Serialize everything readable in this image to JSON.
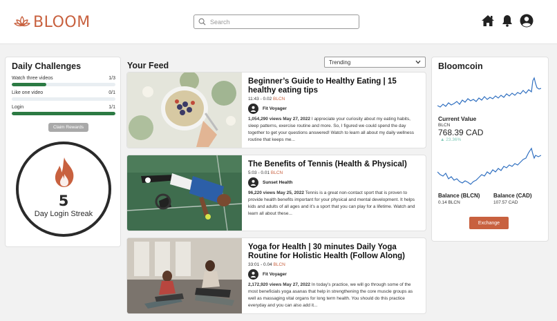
{
  "header": {
    "logo_text": "BLOOM",
    "search_placeholder": "Search"
  },
  "colors": {
    "brand": "#c8613f",
    "progress": "#2b7a43",
    "chart_line": "#2f6fc0"
  },
  "daily_challenges": {
    "title": "Daily Challenges",
    "items": [
      {
        "label": "Watch three videos",
        "progress": "1/3",
        "fraction": 0.333
      },
      {
        "label": "Like one video",
        "progress": "0/1",
        "fraction": 0
      },
      {
        "label": "Login",
        "progress": "1/1",
        "fraction": 1
      }
    ],
    "claim_label": "Claim Rewards",
    "streak_number": "5",
    "streak_label": "Day Login Streak"
  },
  "feed": {
    "title": "Your Feed",
    "sort_selected": "Trending",
    "videos": [
      {
        "title": "Beginner’s Guide to Healthy Eating | 15 healthy eating tips",
        "duration": "11:43 - 0.02",
        "coin": "BLCN",
        "channel": "Fit Voyager",
        "views": "1,054,290 views",
        "date": "May 27, 2022",
        "description": "I appreciate your curiosity about my eating habits, sleep patterns, exercise routine and more. So, I figured we could spend the day together to get your questions answered! Watch to learn all about my daily wellness routine that keeps me..."
      },
      {
        "title": "The Benefits of Tennis (Health & Physical)",
        "duration": "5:03 - 0.01",
        "coin": "BLCN",
        "channel": "Sunset Health",
        "views": "96,220 views",
        "date": "May 25, 2022",
        "description": "Tennis is a great non-contact sport that is proven to provide health benefits important for your physical and mental development. It helps kids and adults of all ages and it’s a sport that you can play for a lifetime. Watch and learn all about these..."
      },
      {
        "title": "Yoga for Health | 30 minutes Daily Yoga Routine for Holistic Health (Follow Along)",
        "duration": "33:01 - 0.04",
        "coin": "BLCN",
        "channel": "Fit Voyager",
        "views": "2,172,920 views",
        "date": "May 27, 2022",
        "description": "In today’s practice, we will go through some of the most beneficials yoga asanas that help in strengthening the core muscle groups as well as massaging vital organs for long term health. You should do this practice everyday and you can also add it..."
      }
    ]
  },
  "bloomcoin": {
    "title": "Bloomcoin",
    "current_value_label": "Current Value",
    "unit": "BLCN",
    "current_value": "768.39 CAD",
    "change": "23.36%",
    "balance_blcn_label": "Balance (BLCN)",
    "balance_blcn": "0.14 BLCN",
    "balance_cad_label": "Balance (CAD)",
    "balance_cad": "107.57 CAD",
    "exchange_label": "Exchange"
  }
}
